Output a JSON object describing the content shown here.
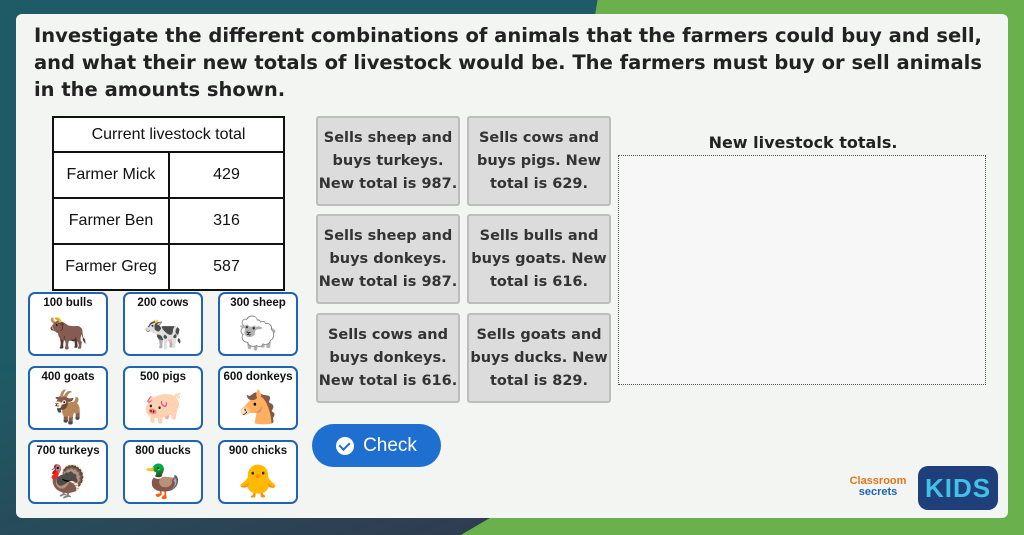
{
  "question": "Investigate the different combinations of animals that the farmers could buy and sell, and what their new totals of livestock would be. The farmers must buy or sell animals in the amounts shown.",
  "table": {
    "header": "Current livestock total",
    "rows": [
      {
        "farmer": "Farmer Mick",
        "total": "429"
      },
      {
        "farmer": "Farmer Ben",
        "total": "316"
      },
      {
        "farmer": "Farmer Greg",
        "total": "587"
      }
    ]
  },
  "animals": [
    {
      "label": "100 bulls",
      "icon": "bull-icon",
      "glyph": "🐂"
    },
    {
      "label": "200 cows",
      "icon": "cow-icon",
      "glyph": "🐄"
    },
    {
      "label": "300 sheep",
      "icon": "sheep-icon",
      "glyph": "🐑"
    },
    {
      "label": "400 goats",
      "icon": "goat-icon",
      "glyph": "🐐"
    },
    {
      "label": "500 pigs",
      "icon": "pig-icon",
      "glyph": "🐖"
    },
    {
      "label": "600 donkeys",
      "icon": "donkey-icon",
      "glyph": "🐴"
    },
    {
      "label": "700 turkeys",
      "icon": "turkey-icon",
      "glyph": "🦃"
    },
    {
      "label": "800 ducks",
      "icon": "duck-icon",
      "glyph": "🦆"
    },
    {
      "label": "900 chicks",
      "icon": "chick-icon",
      "glyph": "🐥"
    }
  ],
  "statements": [
    "Sells sheep and buys turkeys. New total is 987.",
    "Sells cows and buys pigs. New total is 629.",
    "Sells sheep and buys donkeys. New total is 987.",
    "Sells bulls and buys goats. New total is 616.",
    "Sells cows and buys donkeys. New total is 616.",
    "Sells goats and buys ducks. New total is 829."
  ],
  "new_totals_title": "New livestock totals.",
  "check_label": "Check",
  "logo": {
    "classroom": "Classroom",
    "secrets": "secrets",
    "kids": "KIDS"
  },
  "colors": {
    "accent": "#1f6fd1",
    "green": "#6ab04c",
    "card_border": "#1f63b5"
  }
}
